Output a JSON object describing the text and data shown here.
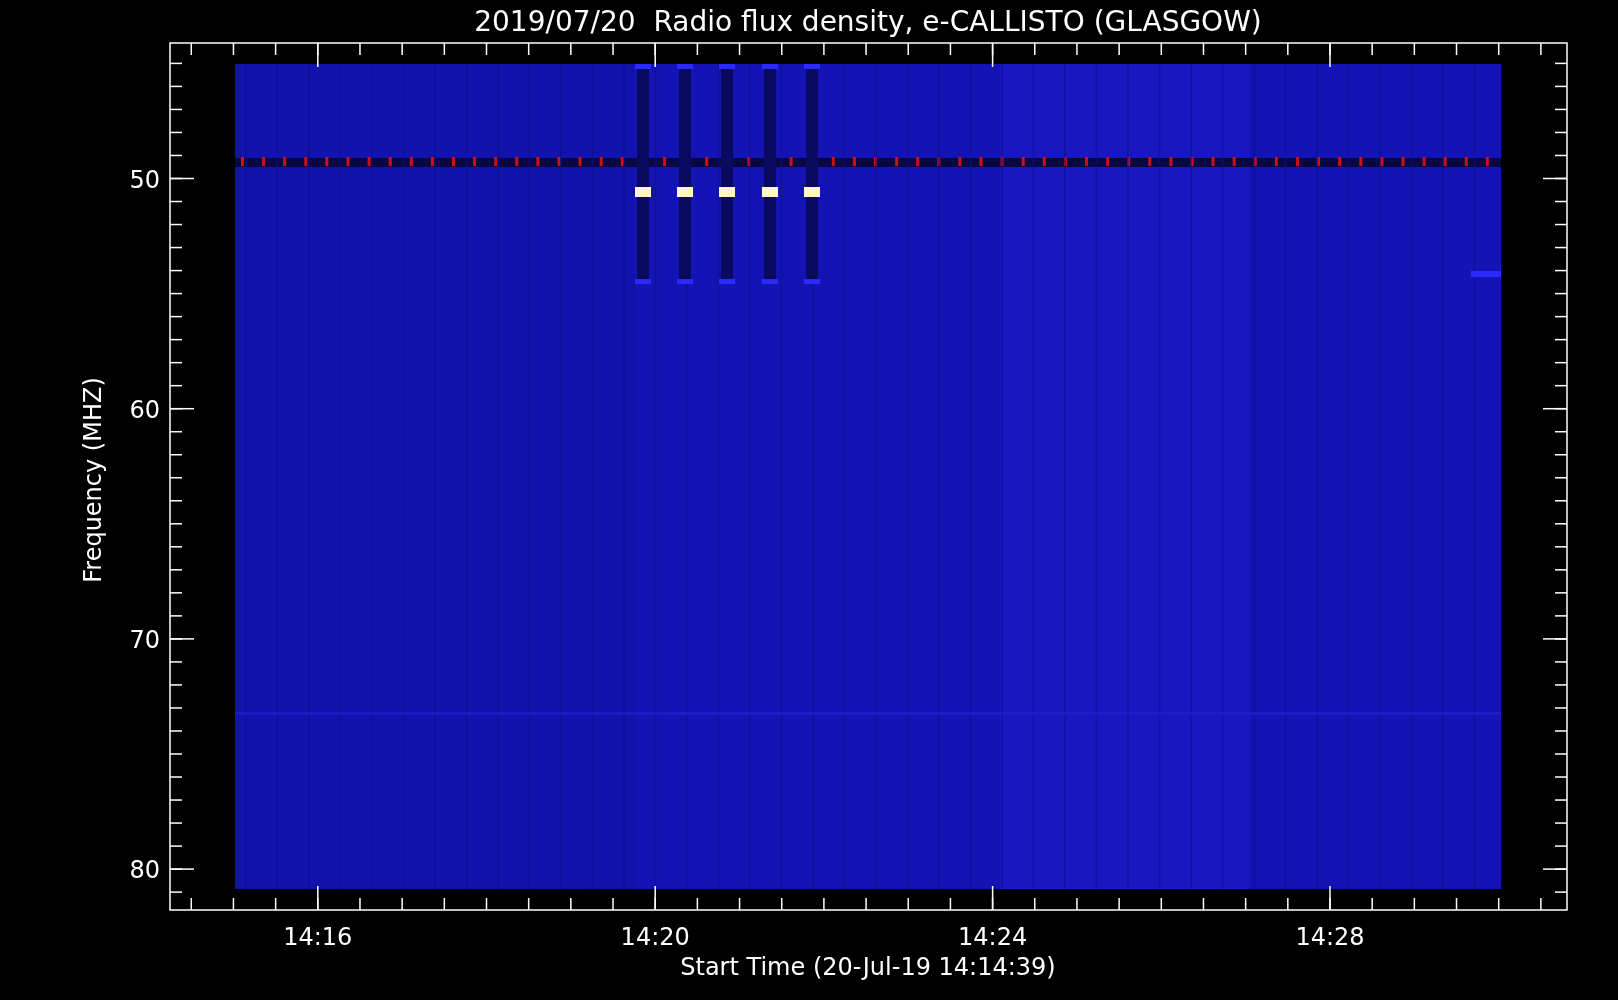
{
  "title": "2019/07/20  Radio flux density, e-CALLISTO (GLASGOW)",
  "x_axis": {
    "label": "Start Time (20-Jul-19 14:14:39)",
    "ticks": [
      "14:16",
      "14:20",
      "14:24",
      "14:28"
    ]
  },
  "y_axis": {
    "label": "Frequency (MHZ)",
    "ticks": [
      "50",
      "60",
      "70",
      "80"
    ]
  }
}
